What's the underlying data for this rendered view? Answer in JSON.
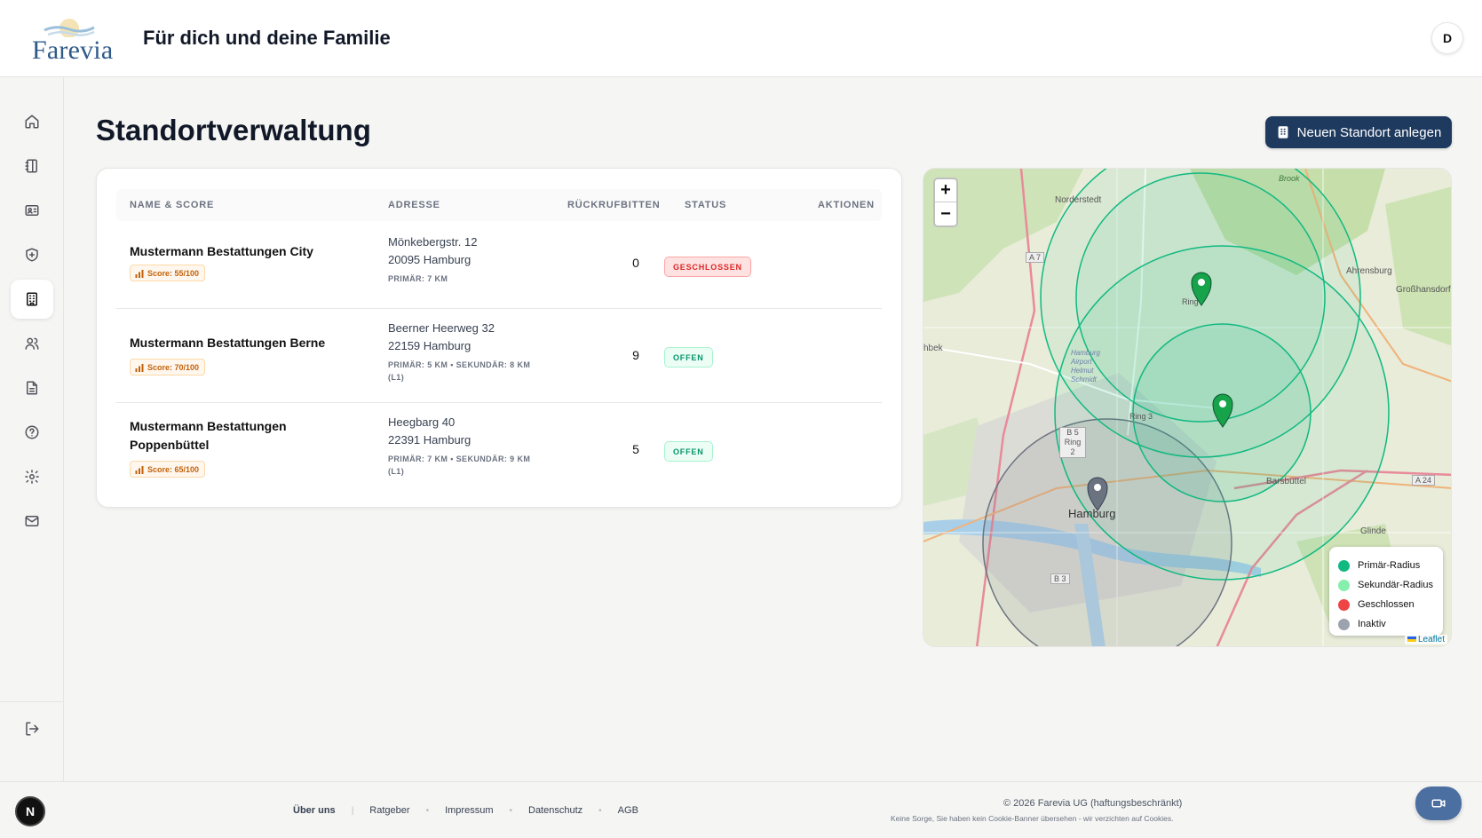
{
  "header": {
    "logo_text": "Farevia",
    "title": "Für dich und deine Familie",
    "avatar_initial": "D"
  },
  "sidebar": {
    "items": [
      {
        "icon": "home-icon",
        "name": "sidebar-item-home",
        "active": false
      },
      {
        "icon": "notebook-icon",
        "name": "sidebar-item-notebook",
        "active": false
      },
      {
        "icon": "id-card-icon",
        "name": "sidebar-item-profile",
        "active": false
      },
      {
        "icon": "shield-plus-icon",
        "name": "sidebar-item-protection",
        "active": false
      },
      {
        "icon": "building-icon",
        "name": "sidebar-item-locations",
        "active": true
      },
      {
        "icon": "users-icon",
        "name": "sidebar-item-users",
        "active": false
      },
      {
        "icon": "document-icon",
        "name": "sidebar-item-documents",
        "active": false
      },
      {
        "icon": "help-circle-icon",
        "name": "sidebar-item-help",
        "active": false
      },
      {
        "icon": "gear-icon",
        "name": "sidebar-item-settings",
        "active": false
      },
      {
        "icon": "mail-icon",
        "name": "sidebar-item-messages",
        "active": false
      }
    ],
    "logout_icon": "logout-icon"
  },
  "main": {
    "page_title": "Standortverwaltung",
    "new_location_label": "Neuen Standort anlegen",
    "new_location_icon": "building-icon"
  },
  "table": {
    "columns": [
      "NAME & SCORE",
      "ADRESSE",
      "RÜCKRUFBITTEN",
      "STATUS",
      "AKTIONEN"
    ],
    "rows": [
      {
        "name": "Mustermann Bestattungen City",
        "score": "Score: 55/100",
        "street": "Mönkebergstr. 12",
        "city": "20095 Hamburg",
        "radius": "PRIMÄR: 7 KM",
        "callbacks": "0",
        "status": "GESCHLOSSEN",
        "status_type": "closed"
      },
      {
        "name": "Mustermann Bestattungen Berne",
        "score": "Score: 70/100",
        "street": "Beerner Heerweg 32",
        "city": "22159 Hamburg",
        "radius": "PRIMÄR: 5 KM • SEKUNDÄR: 8 KM (L1)",
        "callbacks": "9",
        "status": "OFFEN",
        "status_type": "open"
      },
      {
        "name": "Mustermann Bestattungen Poppenbüttel",
        "score": "Score: 65/100",
        "street": "Heegbarg 40",
        "city": "22391 Hamburg",
        "radius": "PRIMÄR: 7 KM • SEKUNDÄR: 9 KM (L1)",
        "callbacks": "5",
        "status": "OFFEN",
        "status_type": "open"
      }
    ]
  },
  "map": {
    "zoom_in": "+",
    "zoom_out": "−",
    "labels": {
      "norderstedt": "Norderstedt",
      "ahrensburg": "Ahrensburg",
      "grosshansdorf": "Großhansdorf",
      "hamburg": "Hamburg",
      "barsbuttel": "Barsbüttel",
      "glinde": "Glinde",
      "brook": "Brook",
      "a7": "A 7",
      "a24": "A 24",
      "b5": "B 5",
      "ring2": "Ring 2",
      "b3": "B 3",
      "ring_top": "Ring",
      "ring_mid": "Ring 3",
      "airport": "Hamburg Airport Helmut Schmidt",
      "hbek": "hbek"
    },
    "legend": [
      {
        "label": "Primär-Radius",
        "color": "#10b981"
      },
      {
        "label": "Sekundär-Radius",
        "color": "#86efac"
      },
      {
        "label": "Geschlossen",
        "color": "#ef4444"
      },
      {
        "label": "Inaktiv",
        "color": "#9ca3af"
      }
    ],
    "attribution": "Leaflet"
  },
  "footer": {
    "next_badge": "N",
    "links": [
      "Über uns",
      "Ratgeber",
      "Impressum",
      "Datenschutz",
      "AGB"
    ],
    "copyright": "© 2026 Farevia UG (haftungsbeschränkt)",
    "cookie_note": "Keine Sorge, Sie haben kein Cookie-Banner übersehen - wir verzichten auf Cookies."
  },
  "colors": {
    "brand": "#1f3a5f",
    "primary_radius": "#10b981",
    "closed": "#dc2626",
    "open": "#059669",
    "score": "#c2620c"
  }
}
